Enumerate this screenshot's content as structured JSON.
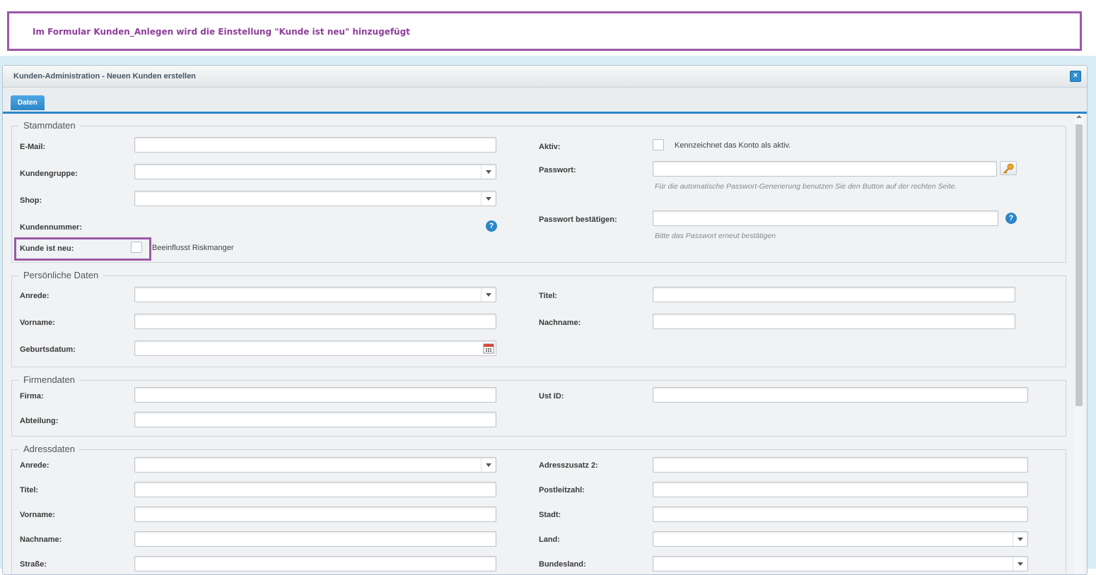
{
  "annotation": {
    "text": "Im Formular Kunden_Anlegen wird die Einstellung \"Kunde ist neu\" hinzugefügt"
  },
  "window": {
    "title": "Kunden-Administration - Neuen Kunden erstellen",
    "close_glyph": "×"
  },
  "tabs": [
    {
      "label": "Daten",
      "active": true
    }
  ],
  "stammdaten": {
    "legend": "Stammdaten",
    "email_label": "E-Mail:",
    "kundengruppe_label": "Kundengruppe:",
    "shop_label": "Shop:",
    "kundennummer_label": "Kundennummer:",
    "kunde_ist_neu_label": "Kunde ist neu:",
    "kunde_ist_neu_note": "Beeinflusst Riskmanger",
    "aktiv_label": "Aktiv:",
    "aktiv_note": "Kennzeichnet das Konto als aktiv.",
    "passwort_label": "Passwort:",
    "passwort_hint": "Für die automatische Passwort-Generierung benutzen Sie den Button auf der rechten Seite.",
    "passwort_bestaetigen_label": "Passwort bestätigen:",
    "passwort_bestaetigen_hint": "Bitte das Passwort erneut bestätigen",
    "help_glyph": "?"
  },
  "persoenliche_daten": {
    "legend": "Persönliche Daten",
    "anrede_label": "Anrede:",
    "vorname_label": "Vorname:",
    "geburtsdatum_label": "Geburtsdatum:",
    "titel_label": "Titel:",
    "nachname_label": "Nachname:"
  },
  "firmendaten": {
    "legend": "Firmendaten",
    "firma_label": "Firma:",
    "abteilung_label": "Abteilung:",
    "ust_id_label": "Ust ID:"
  },
  "adressdaten": {
    "legend": "Adressdaten",
    "anrede_label": "Anrede:",
    "titel_label": "Titel:",
    "vorname_label": "Vorname:",
    "nachname_label": "Nachname:",
    "strasse_label": "Straße:",
    "adresszusatz2_label": "Adresszusatz 2:",
    "postleitzahl_label": "Postleitzahl:",
    "stadt_label": "Stadt:",
    "land_label": "Land:",
    "bundesland_label": "Bundesland:"
  },
  "colors": {
    "accent": "#2b86c8",
    "annotation": "#9b59a6"
  }
}
